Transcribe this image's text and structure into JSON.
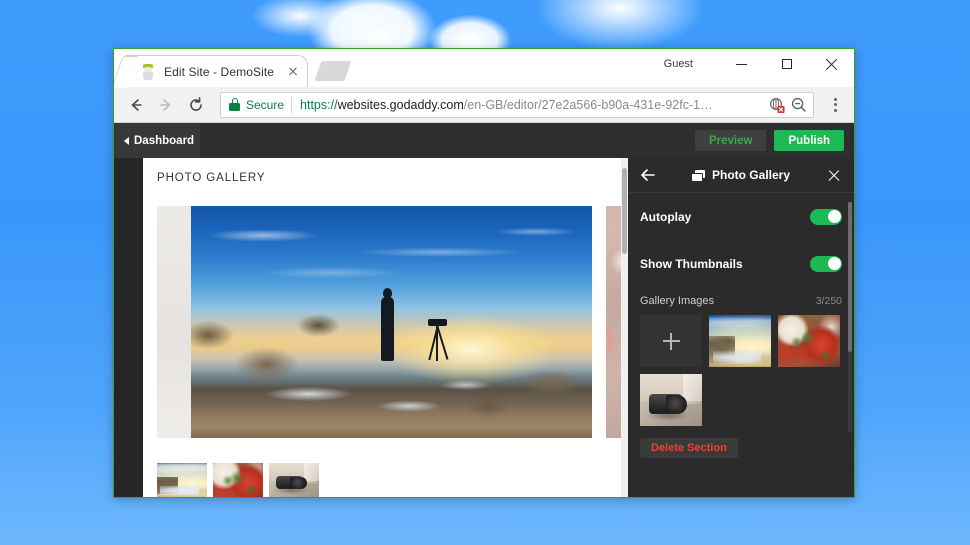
{
  "browser": {
    "tab": {
      "title": "Edit Site - DemoSite",
      "favicon": "godaddy-favicon",
      "close_icon": "close-icon"
    },
    "new_tab_icon": "new-tab-icon",
    "profile_label": "Guest",
    "window_controls": {
      "minimize": "minimize-icon",
      "maximize": "maximize-icon",
      "close": "close-icon"
    },
    "nav": {
      "back_icon": "back-arrow-icon",
      "forward_icon": "forward-arrow-icon",
      "reload_icon": "reload-icon",
      "menu_icon": "three-dots-menu-icon"
    },
    "omnibox": {
      "lock_icon": "lock-icon",
      "security_label": "Secure",
      "url_scheme": "https://",
      "url_host": "websites.godaddy.com",
      "url_path": "/en-GB/editor/27e2a566-b90a-431e-92fc-1…",
      "blocked_content_icon": "blocked-content-icon",
      "zoom_out_icon": "zoom-out-icon"
    }
  },
  "editor": {
    "toolbar": {
      "dashboard_label": "Dashboard",
      "back_caret_icon": "caret-left-icon",
      "preview_label": "Preview",
      "publish_label": "Publish"
    },
    "canvas": {
      "section_title": "PHOTO GALLERY",
      "carousel": {
        "prev_peek": "blank-slide",
        "current_image": "photographer-sunset-mountain",
        "next_peek": "festive-food-table"
      },
      "thumbnails": [
        {
          "name": "photographer-sunset-mountain",
          "selected": true
        },
        {
          "name": "festive-food-table",
          "selected": false
        },
        {
          "name": "vintage-camera-table",
          "selected": false
        }
      ]
    },
    "panel": {
      "title": "Photo Gallery",
      "icon": "gallery-icon",
      "back_icon": "back-arrow-icon",
      "close_icon": "close-icon",
      "settings": [
        {
          "label": "Autoplay",
          "value": "on"
        },
        {
          "label": "Show Thumbnails",
          "value": "on"
        }
      ],
      "gallery_images": {
        "label": "Gallery Images",
        "count": "3/250",
        "add_tile_icon": "plus-icon",
        "images": [
          {
            "name": "photographer-sunset-mountain"
          },
          {
            "name": "festive-food-table"
          },
          {
            "name": "vintage-camera-table"
          }
        ]
      },
      "delete_section_label": "Delete Section"
    }
  },
  "colors": {
    "publish_green": "#1db954",
    "toggle_on": "#1db954",
    "delete_red": "#f0412f",
    "secure_green": "#0b8043",
    "panel_bg": "#2b2b2b",
    "desktop_blue": "#3d9bfb",
    "window_border_green": "#36a12b"
  }
}
